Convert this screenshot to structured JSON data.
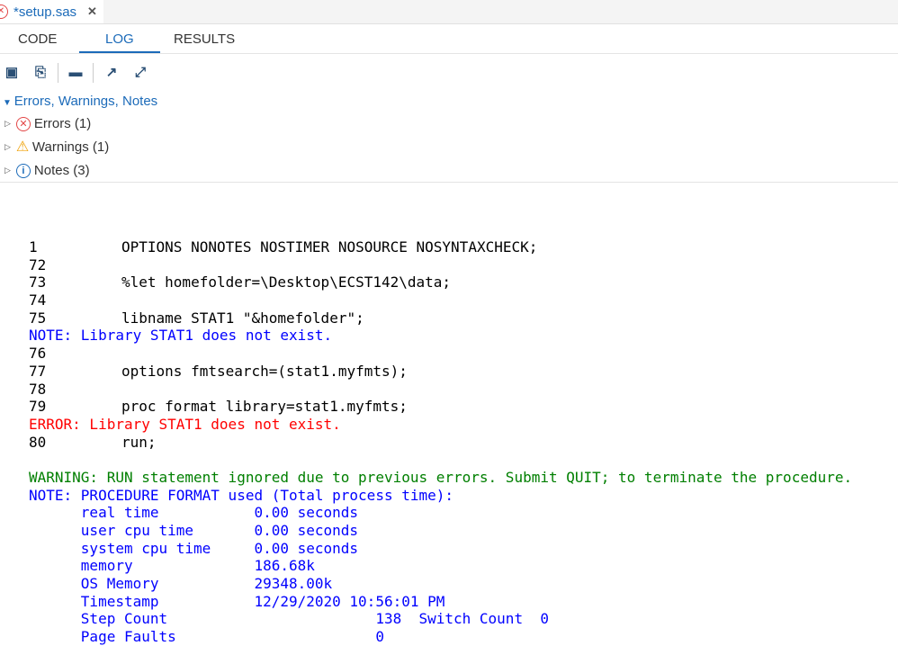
{
  "file_tab": {
    "title": "*setup.sas",
    "close": "✕"
  },
  "tabs": [
    "CODE",
    "LOG",
    "RESULTS"
  ],
  "toolbar": [
    "save-log",
    "download-log",
    "print",
    "pop-out",
    "maximize"
  ],
  "tree": {
    "header": "Errors, Warnings, Notes",
    "items": [
      {
        "label": "Errors (1)"
      },
      {
        "label": "Warnings (1)"
      },
      {
        "label": "Notes (3)"
      }
    ]
  },
  "colors": {
    "accent": "#1c6bb9",
    "note": "#0000ff",
    "error": "#ff0000",
    "warning": "#007f00"
  },
  "log": [
    {
      "n": "1",
      "t": "OPTIONS NONOTES NOSTIMER NOSOURCE NOSYNTAXCHECK;",
      "k": "code"
    },
    {
      "n": "72",
      "t": "",
      "k": "code"
    },
    {
      "n": "73",
      "t": "%let homefolder=\\Desktop\\ECST142\\data;",
      "k": "code"
    },
    {
      "n": "74",
      "t": "",
      "k": "code"
    },
    {
      "n": "75",
      "t": "libname STAT1 \"&homefolder\";",
      "k": "code"
    },
    {
      "t": "NOTE: Library STAT1 does not exist.",
      "k": "note"
    },
    {
      "n": "76",
      "t": "",
      "k": "code"
    },
    {
      "n": "77",
      "t": "options fmtsearch=(stat1.myfmts);",
      "k": "code"
    },
    {
      "n": "78",
      "t": "",
      "k": "code"
    },
    {
      "n": "79",
      "t": "proc format library=stat1.myfmts;",
      "k": "code"
    },
    {
      "t": "ERROR: Library STAT1 does not exist.",
      "k": "error"
    },
    {
      "n": "80",
      "t": "run;",
      "k": "code"
    },
    {
      "t": "",
      "k": "blank"
    },
    {
      "t": "WARNING: RUN statement ignored due to previous errors. Submit QUIT; to terminate the procedure.",
      "k": "warning"
    },
    {
      "t": "NOTE: PROCEDURE FORMAT used (Total process time):",
      "k": "note"
    },
    {
      "t": "      real time           0.00 seconds",
      "k": "note"
    },
    {
      "t": "      user cpu time       0.00 seconds",
      "k": "note"
    },
    {
      "t": "      system cpu time     0.00 seconds",
      "k": "note"
    },
    {
      "t": "      memory              186.68k",
      "k": "note"
    },
    {
      "t": "      OS Memory           29348.00k",
      "k": "note"
    },
    {
      "t": "      Timestamp           12/29/2020 10:56:01 PM",
      "k": "note"
    },
    {
      "t": "      Step Count                        138  Switch Count  0",
      "k": "note"
    },
    {
      "t": "      Page Faults                       0",
      "k": "note"
    }
  ]
}
